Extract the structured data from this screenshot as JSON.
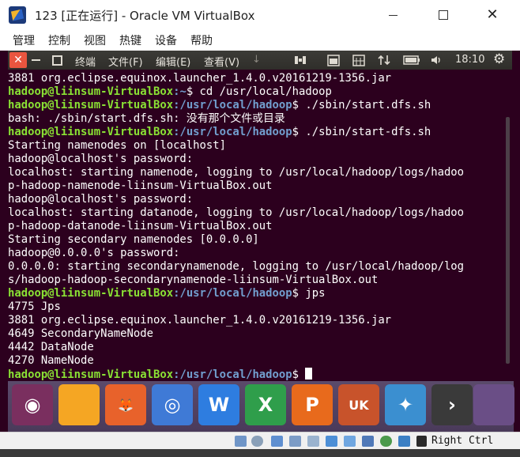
{
  "window": {
    "title": "123 [正在运行] - Oracle VM VirtualBox",
    "minimize_glyph": "—",
    "maximize_glyph": "☐",
    "close_glyph": "✕"
  },
  "host_menu": [
    "管理",
    "控制",
    "视图",
    "热键",
    "设备",
    "帮助"
  ],
  "guest_topbar": {
    "close_glyph": "✕",
    "menus": [
      "终端",
      "文件(F)",
      "编辑(E)",
      "查看(V)"
    ],
    "dropdown_glyph": "↓",
    "clock": "18:10",
    "gear_glyph": "⚙",
    "indicator_icons": [
      "keyboard-input-icon",
      "calendar-icon",
      "network-arrows-icon",
      "battery-icon",
      "speaker-icon"
    ]
  },
  "terminal": {
    "lines": [
      {
        "text": "3881 org.eclipse.equinox.launcher_1.4.0.v20161219-1356.jar"
      },
      {
        "user": "hadoop@liinsum-VirtualBox",
        "path": "~",
        "cmd": "$ cd /usr/local/hadoop"
      },
      {
        "user": "hadoop@liinsum-VirtualBox",
        "path": "/usr/local/hadoop",
        "cmd": "$ ./sbin/start.dfs.sh"
      },
      {
        "text": "bash: ./sbin/start.dfs.sh: 没有那个文件或目录"
      },
      {
        "user": "hadoop@liinsum-VirtualBox",
        "path": "/usr/local/hadoop",
        "cmd": "$ ./sbin/start-dfs.sh"
      },
      {
        "text": "Starting namenodes on [localhost]"
      },
      {
        "text": "hadoop@localhost's password:"
      },
      {
        "text": "localhost: starting namenode, logging to /usr/local/hadoop/logs/hadoo"
      },
      {
        "text": "p-hadoop-namenode-liinsum-VirtualBox.out"
      },
      {
        "text": "hadoop@localhost's password:"
      },
      {
        "text": "localhost: starting datanode, logging to /usr/local/hadoop/logs/hadoo"
      },
      {
        "text": "p-hadoop-datanode-liinsum-VirtualBox.out"
      },
      {
        "text": "Starting secondary namenodes [0.0.0.0]"
      },
      {
        "text": "hadoop@0.0.0.0's password:"
      },
      {
        "text": "0.0.0.0: starting secondarynamenode, logging to /usr/local/hadoop/log"
      },
      {
        "text": "s/hadoop-hadoop-secondarynamenode-liinsum-VirtualBox.out"
      },
      {
        "user": "hadoop@liinsum-VirtualBox",
        "path": "/usr/local/hadoop",
        "cmd": "$ jps"
      },
      {
        "text": "4775 Jps"
      },
      {
        "text": "3881 org.eclipse.equinox.launcher_1.4.0.v20161219-1356.jar"
      },
      {
        "text": "4649 SecondaryNameNode"
      },
      {
        "text": "4442 DataNode"
      },
      {
        "text": "4270 NameNode"
      },
      {
        "user": "hadoop@liinsum-VirtualBox",
        "path": "/usr/local/hadoop",
        "cmd": "$ ",
        "cursor": true
      }
    ]
  },
  "launcher": [
    {
      "name": "ubuntu-dash-icon",
      "color": "#7a2f5f",
      "glyph": "◉"
    },
    {
      "name": "files-icon",
      "color": "#f5a623",
      "glyph": ""
    },
    {
      "name": "firefox-icon",
      "color": "#e8622b",
      "glyph": "🦊"
    },
    {
      "name": "chromium-icon",
      "color": "#3f7ad6",
      "glyph": "◎"
    },
    {
      "name": "wps-writer-icon",
      "color": "#2e7de0",
      "glyph": "W"
    },
    {
      "name": "wps-spreadsheets-icon",
      "color": "#2f9e4b",
      "glyph": "X"
    },
    {
      "name": "wps-presentation-icon",
      "color": "#e86a1c",
      "glyph": "P"
    },
    {
      "name": "ubuntu-software-icon",
      "color": "#c8532b",
      "glyph": "UK"
    },
    {
      "name": "amazon-icon",
      "color": "#3b8fd0",
      "glyph": "✦"
    },
    {
      "name": "terminal-icon",
      "color": "#3a3a3a",
      "glyph": "›"
    },
    {
      "name": "more-apps-icon",
      "color": "#6a4e86",
      "glyph": ""
    }
  ],
  "statusbar": {
    "host_key": "Right Ctrl"
  },
  "colors": {
    "terminal_bg": "#2c001e",
    "prompt_user": "#8ae234",
    "prompt_path": "#729fcf"
  }
}
